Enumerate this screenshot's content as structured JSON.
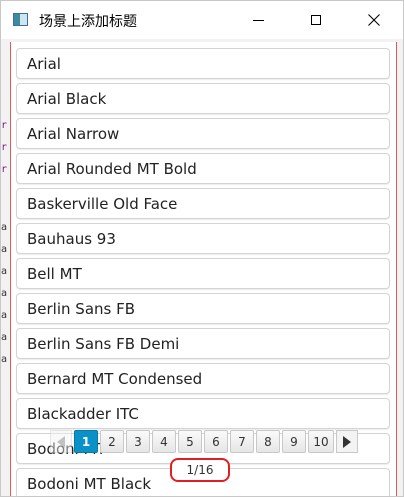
{
  "window": {
    "title": "场景上添加标题"
  },
  "fonts": {
    "items": [
      "Arial",
      "Arial Black",
      "Arial Narrow",
      "Arial Rounded MT Bold",
      "Baskerville Old Face",
      "Bauhaus 93",
      "Bell MT",
      "Berlin Sans FB",
      "Berlin Sans FB Demi",
      "Bernard MT Condensed",
      "Blackadder ITC",
      "Bodoni MT",
      "Bodoni MT Black"
    ]
  },
  "pagination": {
    "pages": [
      "1",
      "2",
      "3",
      "4",
      "5",
      "6",
      "7",
      "8",
      "9",
      "10"
    ],
    "current_page": 1,
    "page_info": "1/16"
  },
  "background": {
    "fragments": [
      "r",
      "r",
      "r",
      "a",
      "a",
      "a",
      "a",
      "a",
      "a",
      "a"
    ]
  },
  "colors": {
    "accent": "#0a92c8",
    "highlight_border": "#e02020",
    "panel_border": "#e05a5a"
  },
  "icons": {
    "app": "app-window-icon",
    "minimize": "minimize-icon",
    "maximize": "maximize-icon",
    "close": "close-icon",
    "prev": "triangle-left-icon",
    "next": "triangle-right-icon"
  }
}
